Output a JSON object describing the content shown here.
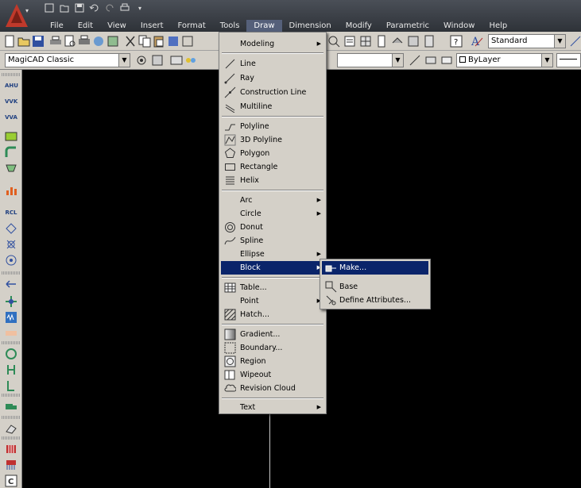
{
  "menubar": {
    "items": [
      "File",
      "Edit",
      "View",
      "Insert",
      "Format",
      "Tools",
      "Draw",
      "Dimension",
      "Modify",
      "Parametric",
      "Window",
      "Help"
    ],
    "active": "Draw"
  },
  "toolbar": {
    "text_style": "Standard",
    "workspace": "MagiCAD Classic",
    "layer": "ByLayer"
  },
  "left_toolbar": {
    "labels": [
      "AHU",
      "VVK",
      "VVA",
      "RCL"
    ]
  },
  "draw_menu": {
    "modeling": "Modeling",
    "line": "Line",
    "ray": "Ray",
    "construction_line": "Construction Line",
    "multiline": "Multiline",
    "polyline": "Polyline",
    "polyline_3d": "3D Polyline",
    "polygon": "Polygon",
    "rectangle": "Rectangle",
    "helix": "Helix",
    "arc": "Arc",
    "circle": "Circle",
    "donut": "Donut",
    "spline": "Spline",
    "ellipse": "Ellipse",
    "block": "Block",
    "table": "Table...",
    "point": "Point",
    "hatch": "Hatch...",
    "gradient": "Gradient...",
    "boundary": "Boundary...",
    "region": "Region",
    "wipeout": "Wipeout",
    "revision_cloud": "Revision Cloud",
    "text": "Text"
  },
  "block_menu": {
    "make": "Make...",
    "base": "Base",
    "define_attributes": "Define Attributes..."
  },
  "colors": {
    "menu_bg": "#d4d0c8",
    "highlight": "#0a246a",
    "canvas": "#000000",
    "titlebar": "#3a3f47",
    "logo": "#c0392b"
  }
}
